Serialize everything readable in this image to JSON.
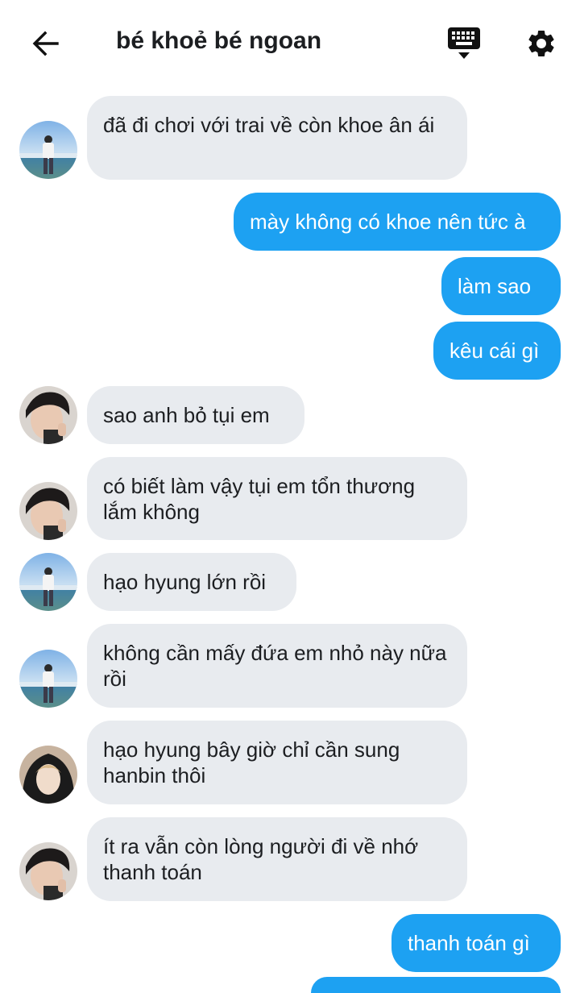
{
  "header": {
    "title": "bé khoẻ bé ngoan",
    "back_icon": "arrow-left-icon",
    "keyboard_icon": "keyboard-icon",
    "settings_icon": "gear-icon"
  },
  "colors": {
    "incoming_bubble": "#e8ebef",
    "outgoing_bubble": "#1da1f2",
    "text_dark": "#1c1e21",
    "text_light": "#ffffff"
  },
  "messages": [
    {
      "direction": "in",
      "sender": "avatar-beach",
      "text": "đã đi chơi với trai về còn khoe ân ái"
    },
    {
      "direction": "out",
      "text": "mày không có khoe nên tức à"
    },
    {
      "direction": "out",
      "text": "làm sao"
    },
    {
      "direction": "out",
      "text": "kêu cái gì"
    },
    {
      "direction": "in",
      "sender": "avatar-dark-hair",
      "text": "sao anh bỏ tụi em"
    },
    {
      "direction": "in",
      "sender": "avatar-dark-hair",
      "text": "có biết làm vậy tụi em tổn thương lắm không"
    },
    {
      "direction": "in",
      "sender": "avatar-beach",
      "text": "hạo hyung lớn rồi"
    },
    {
      "direction": "in",
      "sender": "avatar-beach",
      "text": "không cần mấy đứa em nhỏ này nữa rồi"
    },
    {
      "direction": "in",
      "sender": "avatar-hooded",
      "text": "hạo hyung bây giờ chỉ cần sung hanbin thôi"
    },
    {
      "direction": "in",
      "sender": "avatar-dark-hair",
      "text": "ít ra vẫn còn lòng người đi về nhớ thanh toán"
    },
    {
      "direction": "out",
      "text": "thanh toán gì"
    }
  ]
}
